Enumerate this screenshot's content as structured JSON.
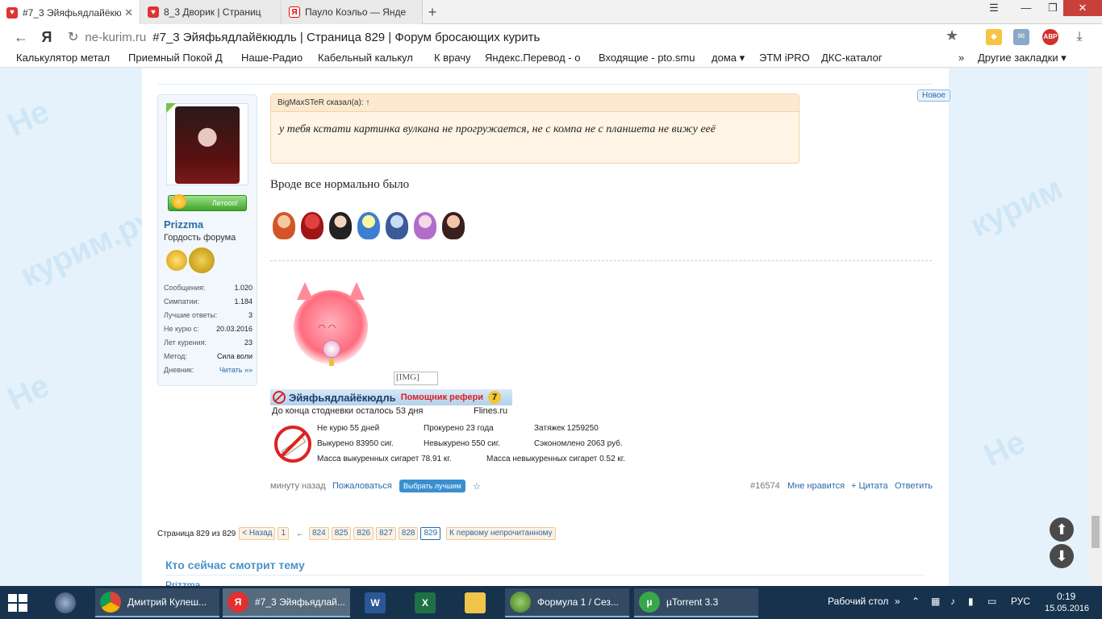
{
  "browser": {
    "tabs": [
      {
        "title": "#7_3 Эйяфьядлайёкюдль",
        "icon": "heart-favicon",
        "active": true
      },
      {
        "title": "8_3 Дворик | Страниц",
        "icon": "heart-favicon",
        "active": false
      },
      {
        "title": "Пауло Коэльо — Янде",
        "icon": "yandex-favicon",
        "active": false
      }
    ],
    "yandex_letter": "Я",
    "url_host": "ne-kurim.ru",
    "url_title": "#7_3 Эйяфьядлайёкюдль | Страница 829 | Форум бросающих курить",
    "abp_label": "ABP",
    "bookmarks": [
      "Калькулятор метал",
      "Приемный Покой Д",
      "Наше-Радио",
      "Кабельный калькул",
      "К врачу",
      "Яндекс.Перевод - о",
      "Входящие - pto.smu",
      "дома ▾",
      "ЭТМ iPRO",
      "ДКС-каталог"
    ],
    "bookmarks_more": "»",
    "bookmarks_other": "Другие закладки ▾"
  },
  "post": {
    "user": {
      "name": "Prizzma",
      "title": "Гордость форума",
      "status": "Летооо!",
      "stats": [
        {
          "label": "Сообщения:",
          "value": "1.020"
        },
        {
          "label": "Симпатии:",
          "value": "1.184"
        },
        {
          "label": "Лучшие ответы:",
          "value": "3"
        },
        {
          "label": "Не курю с:",
          "value": "20.03.2016"
        },
        {
          "label": "Лет курения:",
          "value": "23"
        },
        {
          "label": "Метод:",
          "value": "Сила воли"
        },
        {
          "label": "Дневник:",
          "value": "Читать »»"
        }
      ]
    },
    "new_badge": "Новое",
    "quote_author": "BigMaxSTeR сказал(а): ↑",
    "quote_text": "у тебя кстати картинка вулкана не прогружается, не с компа не с планшета не вижу еeё",
    "message": "Вроде все нормально было",
    "broken_img": "[IMG]",
    "signature": {
      "name": "Эйяфьядлайёкюдль",
      "helper": "Помощник рефери",
      "level": "7",
      "countdown": "До конца стодневки осталось 53 дня",
      "site": "Flines.ru",
      "not_smoking": "Не курю 55 дней",
      "smoked_years": "Прокурено 23 года",
      "puffs": "Затяжек 1259250",
      "smoked_cigs": "Выкурено 83950 сиг.",
      "not_smoked_cigs": "Невыкурено 550 сиг.",
      "saved": "Сэкономлено 2063 руб.",
      "mass_smoked": "Масса выкуренных сигарет 78.91 кг.",
      "mass_not_smoked": "Масса невыкуренных сигарет 0.52 кг."
    },
    "footer": {
      "time": "минуту назад",
      "report": "Пожаловаться",
      "best": "Выбрать лучшим",
      "star": "☆",
      "post_id": "#16574",
      "like": "Мне нравится",
      "quote": "+ Цитата",
      "reply": "Ответить"
    }
  },
  "pager": {
    "info": "Страница 829 из 829",
    "back": "< Назад",
    "first": "1",
    "ellipsis": "←",
    "pages": [
      "824",
      "825",
      "826",
      "827",
      "828"
    ],
    "current": "829",
    "unread": "К первому непрочитанному"
  },
  "watchers": {
    "title": "Кто сейчас смотрит тему",
    "user": "Prizzma"
  },
  "taskbar": {
    "items": [
      {
        "label": "Дмитрий Кулеш...",
        "icon": "chrome-icon"
      },
      {
        "label": "#7_3 Эйяфьядлай...",
        "icon": "yandex-browser-icon"
      },
      {
        "label": "Формула 1 / Сез...",
        "icon": "f1-icon"
      },
      {
        "label": "µTorrent 3.3",
        "icon": "utorrent-icon"
      }
    ],
    "word_letter": "W",
    "excel_letter": "X",
    "desktop": "Рабочий стол",
    "lang": "РУС",
    "time": "0:19",
    "date": "15.05.2016"
  },
  "colors": {
    "link": "#2a6aa8",
    "quote_bg": "#fff4e6",
    "taskbar": "#17324d",
    "close_button": "#c7413a"
  }
}
